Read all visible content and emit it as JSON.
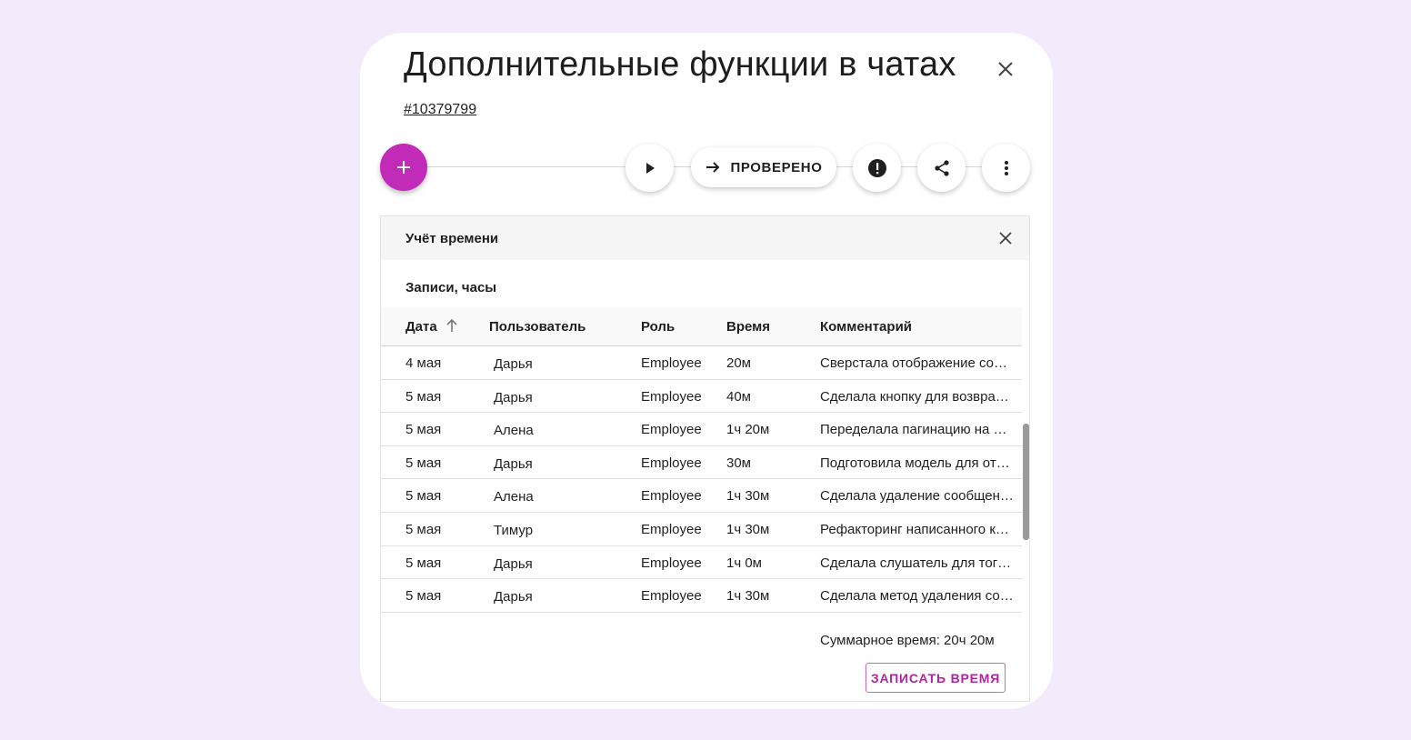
{
  "header": {
    "title": "Дополнительные функции в чатах",
    "task_id": "#10379799"
  },
  "toolbar": {
    "add_label": "+",
    "status_button_label": "ПРОВЕРЕНО",
    "icons": [
      "play-icon",
      "arrow-right-icon",
      "alert-icon",
      "share-icon",
      "more-vert-icon",
      "close-icon"
    ]
  },
  "colors": {
    "accent": "#c12bb7",
    "background": "#f3ebfb",
    "outline_accent": "#cf62c6"
  },
  "time_panel": {
    "title": "Учёт времени",
    "section_title": "Записи, часы",
    "columns": [
      "Дата",
      "Пользователь",
      "Роль",
      "Время",
      "Комментарий"
    ],
    "rows": [
      {
        "date": "4 мая",
        "user": "Дарья",
        "role": "Employee",
        "time": "20м",
        "comment": "Сверстала отображение со…"
      },
      {
        "date": "5 мая",
        "user": "Дарья",
        "role": "Employee",
        "time": "40м",
        "comment": "Сделала кнопку для возвра…"
      },
      {
        "date": "5 мая",
        "user": "Алена",
        "role": "Employee",
        "time": "1ч 20м",
        "comment": "Переделала пагинацию на …"
      },
      {
        "date": "5 мая",
        "user": "Дарья",
        "role": "Employee",
        "time": "30м",
        "comment": "Подготовила модель для от…"
      },
      {
        "date": "5 мая",
        "user": "Алена",
        "role": "Employee",
        "time": "1ч 30м",
        "comment": "Сделала удаление сообщен…"
      },
      {
        "date": "5 мая",
        "user": "Тимур",
        "role": "Employee",
        "time": "1ч 30м",
        "comment": "Рефакторинг написанного к…"
      },
      {
        "date": "5 мая",
        "user": "Дарья",
        "role": "Employee",
        "time": "1ч 0м",
        "comment": "Сделала слушатель для тог…"
      },
      {
        "date": "5 мая",
        "user": "Дарья",
        "role": "Employee",
        "time": "1ч 30м",
        "comment": "Сделала метод удаления со…"
      }
    ],
    "total": "Суммарное время: 20ч 20м",
    "record_button_label": "ЗАПИСАТЬ ВРЕМЯ"
  }
}
